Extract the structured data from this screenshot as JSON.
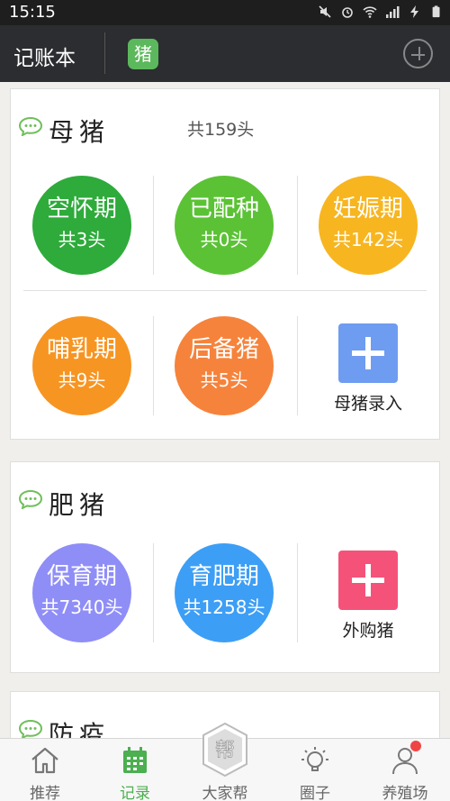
{
  "status": {
    "time": "15:15"
  },
  "appbar": {
    "title": "记账本",
    "animal_badge": "猪"
  },
  "sow": {
    "title": "母猪",
    "total": "共159头",
    "stages": [
      {
        "name": "空怀期",
        "count": "共3头",
        "color": "#2eab3b"
      },
      {
        "name": "已配种",
        "count": "共0头",
        "color": "#5bc236"
      },
      {
        "name": "妊娠期",
        "count": "共142头",
        "color": "#f7b520"
      },
      {
        "name": "哺乳期",
        "count": "共9头",
        "color": "#f79522"
      },
      {
        "name": "后备猪",
        "count": "共5头",
        "color": "#f6833b"
      }
    ],
    "add_label": "母猪录入",
    "add_color": "#6e9cf0"
  },
  "fattening": {
    "title": "肥猪",
    "stages": [
      {
        "name": "保育期",
        "count": "共7340头",
        "color": "#8f8ef7"
      },
      {
        "name": "育肥期",
        "count": "共1258头",
        "color": "#3d9ef5"
      }
    ],
    "add_label": "外购猪",
    "add_color": "#f5527a"
  },
  "vaccine": {
    "title": "防疫"
  },
  "tabs": [
    {
      "label": "推荐",
      "icon": "home-icon"
    },
    {
      "label": "记录",
      "icon": "calendar-icon"
    },
    {
      "label": "大家帮",
      "icon": "help-badge-icon",
      "badge_text": "帮"
    },
    {
      "label": "圈子",
      "icon": "lightbulb-icon"
    },
    {
      "label": "养殖场",
      "icon": "person-icon"
    }
  ],
  "colors": {
    "accent": "#4caf50",
    "appbar": "#2b2d30"
  }
}
